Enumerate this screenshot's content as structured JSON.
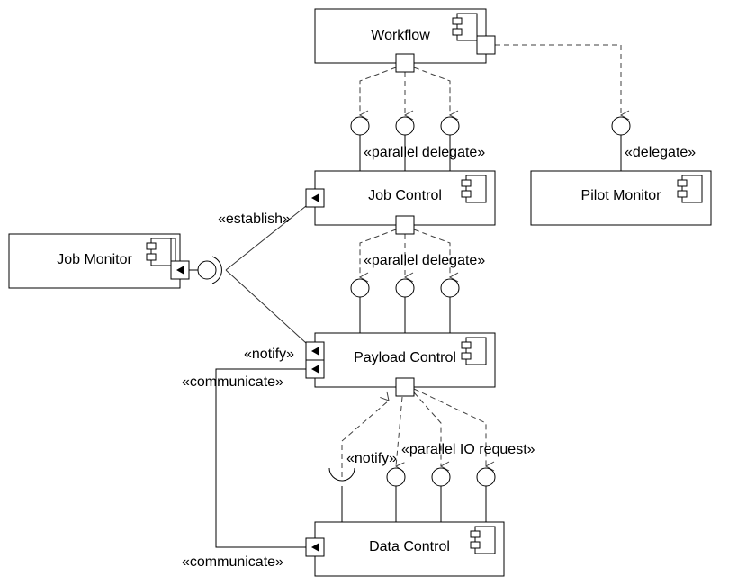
{
  "diagram": {
    "type": "UML component diagram",
    "components": [
      {
        "id": "workflow",
        "name": "Workflow"
      },
      {
        "id": "pilot_monitor",
        "name": "Pilot Monitor"
      },
      {
        "id": "job_control",
        "name": "Job Control"
      },
      {
        "id": "job_monitor",
        "name": "Job Monitor"
      },
      {
        "id": "payload_control",
        "name": "Payload Control"
      },
      {
        "id": "data_control",
        "name": "Data Control"
      }
    ],
    "stereotypes": {
      "workflow_to_job_control": "«parallel delegate»",
      "workflow_to_pilot_monitor": "«delegate»",
      "job_control_to_payload_control": "«parallel delegate»",
      "job_monitor_establish": "«establish»",
      "payload_notify": "«notify»",
      "payload_communicate": "«communicate»",
      "data_notify": "«notify»",
      "data_parallel_io": "«parallel IO request»",
      "data_communicate": "«communicate»"
    },
    "connections": [
      {
        "from": "Workflow",
        "to": "Job Control",
        "kind": "delegate",
        "count": 3,
        "stereotype": "«parallel delegate»"
      },
      {
        "from": "Workflow",
        "to": "Pilot Monitor",
        "kind": "delegate",
        "count": 1,
        "stereotype": "«delegate»"
      },
      {
        "from": "Job Control",
        "to": "Payload Control",
        "kind": "delegate",
        "count": 3,
        "stereotype": "«parallel delegate»"
      },
      {
        "from": "Job Monitor",
        "to": "Job Control",
        "kind": "assembly",
        "stereotype": "«establish»"
      },
      {
        "from": "Job Monitor",
        "to": "Payload Control",
        "kind": "assembly",
        "stereotype": "«notify»"
      },
      {
        "from": "Payload Control",
        "to": "Data Control",
        "kind": "assembly",
        "stereotype": "«communicate»"
      },
      {
        "from": "Payload Control",
        "to": "Data Control",
        "kind": "delegate",
        "count": 3,
        "stereotype": "«parallel IO request»"
      },
      {
        "from": "Data Control",
        "to": "Payload Control",
        "kind": "required",
        "stereotype": "«notify»"
      }
    ]
  }
}
